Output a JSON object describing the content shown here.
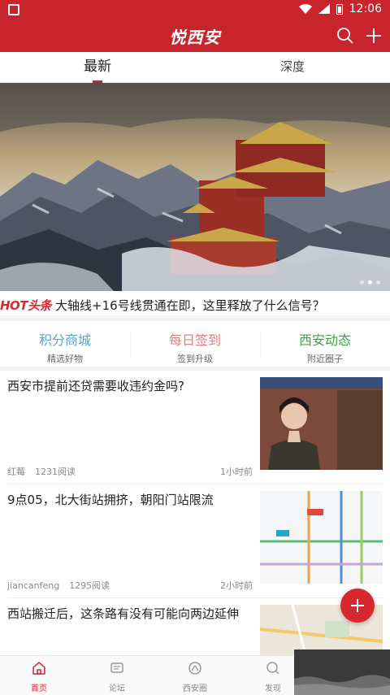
{
  "status_bar": {
    "time": "12:06"
  },
  "app": {
    "title": "悦西安"
  },
  "tabs": [
    {
      "label": "最新",
      "active": true
    },
    {
      "label": "深度",
      "active": false
    }
  ],
  "banner": {
    "dots": 3,
    "active_dot": 1
  },
  "hot": {
    "badge": "HOT头条",
    "headline": "大轴线+16号线贯通在即，这里释放了什么信号？"
  },
  "quick_links": [
    {
      "title": "积分商城",
      "subtitle": "精选好物",
      "color": "#5aa3dd"
    },
    {
      "title": "每日签到",
      "subtitle": "签到升级",
      "color": "#e87b7b"
    },
    {
      "title": "西安动态",
      "subtitle": "附近圈子",
      "color": "#3ba345"
    }
  ],
  "news": [
    {
      "headline": "西安市提前还贷需要收违约金吗?",
      "author": "红莓",
      "views": "1231阅读",
      "time": "1小时前"
    },
    {
      "headline": "9点05，北大街站拥挤，朝阳门站限流",
      "author": "jiancanfeng",
      "views": "1295阅读",
      "time": "2小时前"
    },
    {
      "headline": "西站搬迁后，这条路有没有可能向两边延伸",
      "author": "",
      "views": "",
      "time": ""
    }
  ],
  "bottom_nav": [
    {
      "label": "首页",
      "icon": "home-icon",
      "active": true
    },
    {
      "label": "论坛",
      "icon": "forum-icon",
      "active": false
    },
    {
      "label": "西安圈",
      "icon": "circle-icon",
      "active": false
    },
    {
      "label": "发现",
      "icon": "discover-icon",
      "active": false
    }
  ],
  "colors": {
    "brand": "#c8242b",
    "accent": "#d7282f"
  }
}
